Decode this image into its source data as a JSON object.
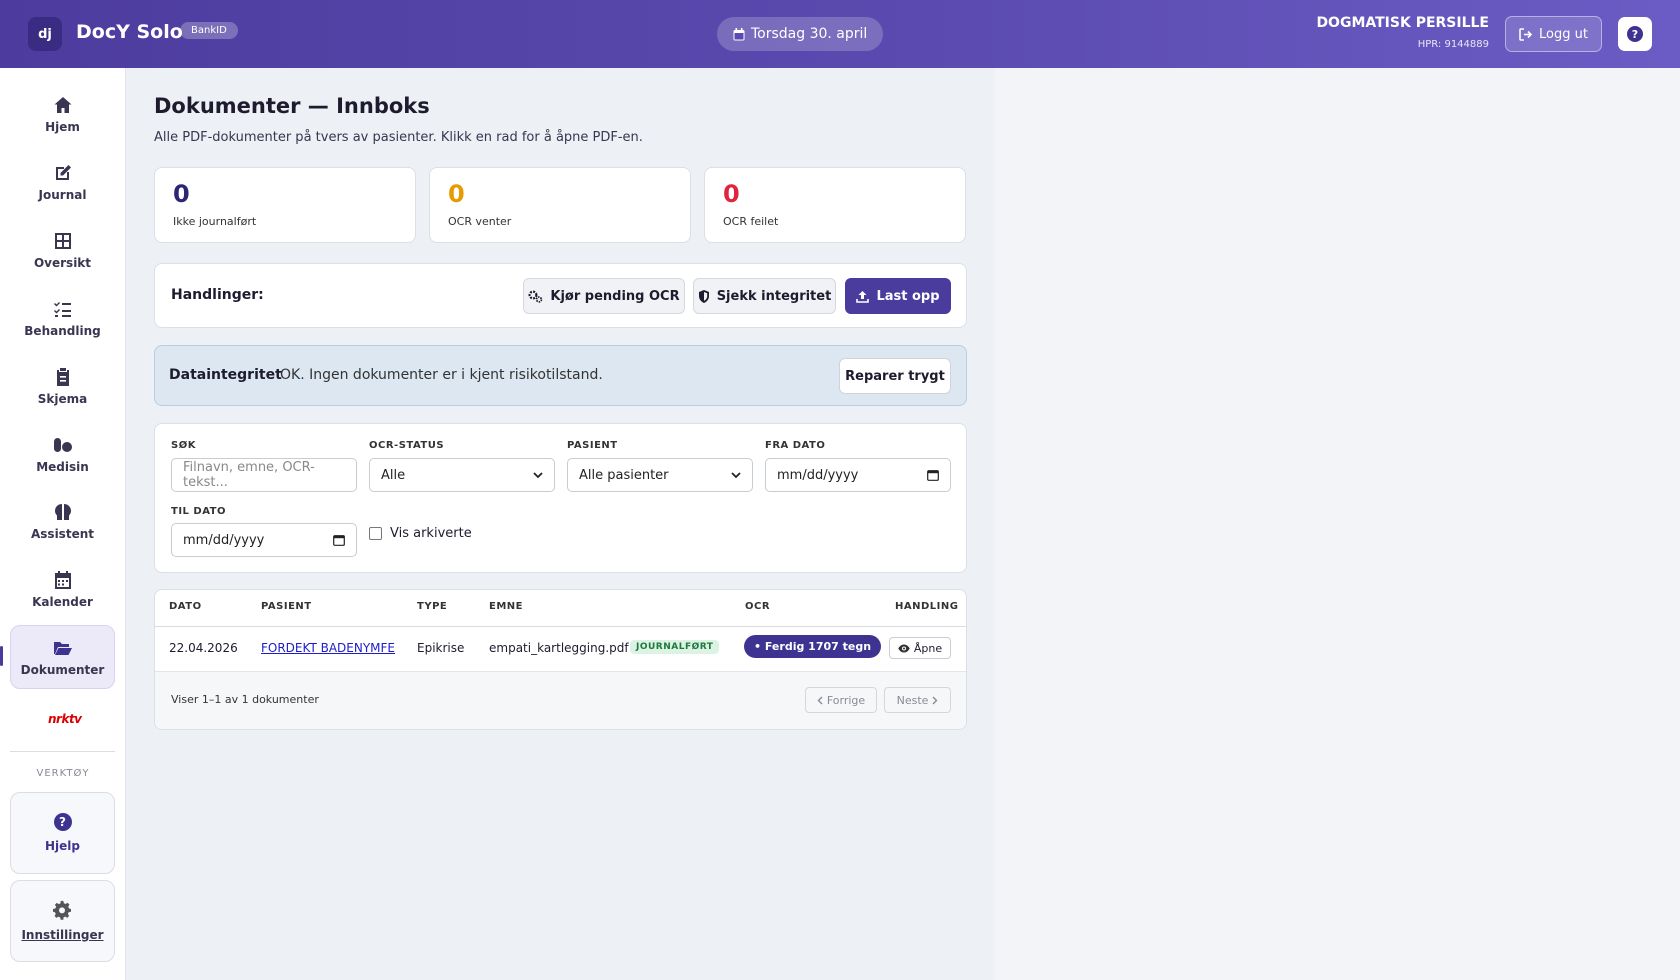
{
  "header": {
    "logo": "dj",
    "app_name": "DocY Solo",
    "badge": "BankID",
    "date": "Torsdag 30. april",
    "user_name": "DOGMATISK PERSILLE",
    "user_hpr": "HPR: 9144889",
    "logout_label": "Logg ut",
    "help_icon": "?"
  },
  "sidebar": {
    "items": [
      {
        "label": "Hjem",
        "icon": "home-icon"
      },
      {
        "label": "Journal",
        "icon": "edit-icon"
      },
      {
        "label": "Oversikt",
        "icon": "grid-icon"
      },
      {
        "label": "Behandling",
        "icon": "checklist-icon"
      },
      {
        "label": "Skjema",
        "icon": "clipboard-icon"
      },
      {
        "label": "Medisin",
        "icon": "pills-icon"
      },
      {
        "label": "Assistent",
        "icon": "brain-icon"
      },
      {
        "label": "Kalender",
        "icon": "calendar-icon"
      },
      {
        "label": "Dokumenter",
        "icon": "folder-open-icon",
        "active": true
      }
    ],
    "nrk_logo": "nrktv",
    "tools_heading": "VERKTØY",
    "help_label": "Hjelp",
    "settings_label": "Innstillinger"
  },
  "main": {
    "title": "Dokumenter — Innboks",
    "subtitle": "Alle PDF-dokumenter på tvers av pasienter. Klikk en rad for å åpne PDF-en.",
    "stats": [
      {
        "value": "0",
        "label": "Ikke journalført",
        "color": "#2e2577"
      },
      {
        "value": "0",
        "label": "OCR venter",
        "color": "#e69b00"
      },
      {
        "value": "0",
        "label": "OCR feilet",
        "color": "#e0243e"
      }
    ],
    "actions": {
      "title": "Handlinger:",
      "run_ocr": "Kjør pending OCR",
      "check_integrity": "Sjekk integritet",
      "upload": "Last opp"
    },
    "integrity": {
      "title": "Dataintegritet",
      "message": "OK. Ingen dokumenter er i kjent risikotilstand.",
      "repair": "Reparer trygt"
    },
    "filters": {
      "search_label": "SØK",
      "search_placeholder": "Filnavn, emne, OCR-tekst...",
      "ocr_label": "OCR-STATUS",
      "ocr_value": "Alle",
      "patient_label": "PASIENT",
      "patient_value": "Alle pasienter",
      "from_label": "FRA DATO",
      "from_value": "mm/dd/yyyy",
      "to_label": "TIL DATO",
      "to_value": "mm/dd/yyyy",
      "archived_label": "Vis arkiverte"
    },
    "table": {
      "headers": [
        "DATO",
        "PASIENT",
        "TYPE",
        "EMNE",
        "OCR",
        "HANDLING"
      ],
      "rows": [
        {
          "date": "22.04.2026",
          "patient": "FORDEKT BADENYMFE",
          "type": "Epikrise",
          "subject": "empati_kartlegging.pdf",
          "tag": "JOURNALFØRT",
          "ocr": "• Ferdig 1707 tegn",
          "action": "Åpne"
        }
      ],
      "summary": "Viser 1–1 av 1 dokumenter",
      "prev": "Forrige",
      "next": "Neste"
    }
  }
}
